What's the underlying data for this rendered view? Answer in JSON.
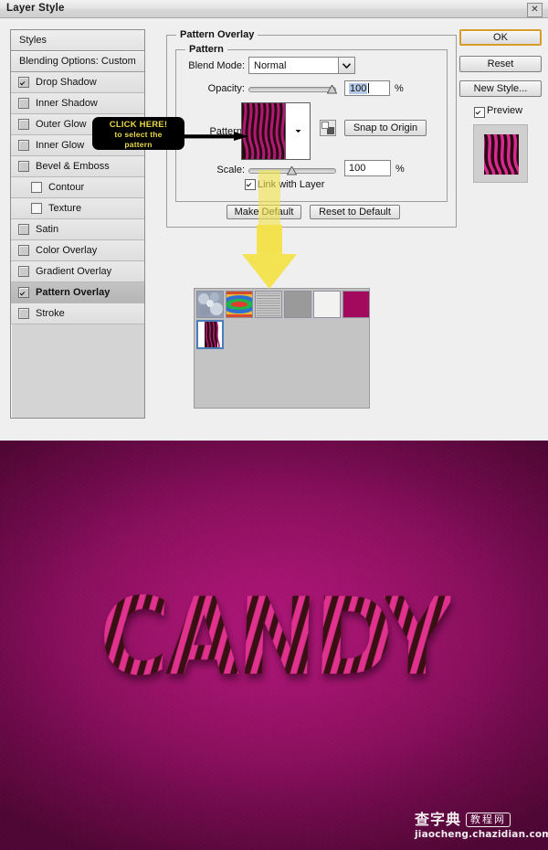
{
  "window": {
    "title": "Layer Style",
    "close_label": "✕"
  },
  "styles_panel": {
    "header": "Styles",
    "blending_options": "Blending Options: Custom",
    "effects": [
      {
        "label": "Drop Shadow",
        "checked": true,
        "indent": false,
        "selected": false
      },
      {
        "label": "Inner Shadow",
        "checked": false,
        "indent": false,
        "selected": false
      },
      {
        "label": "Outer Glow",
        "checked": false,
        "indent": false,
        "selected": false
      },
      {
        "label": "Inner Glow",
        "checked": false,
        "indent": false,
        "selected": false
      },
      {
        "label": "Bevel & Emboss",
        "checked": false,
        "indent": false,
        "selected": false
      },
      {
        "label": "Contour",
        "checked": false,
        "indent": true,
        "selected": false
      },
      {
        "label": "Texture",
        "checked": false,
        "indent": true,
        "selected": false
      },
      {
        "label": "Satin",
        "checked": false,
        "indent": false,
        "selected": false
      },
      {
        "label": "Color Overlay",
        "checked": false,
        "indent": false,
        "selected": false
      },
      {
        "label": "Gradient Overlay",
        "checked": false,
        "indent": false,
        "selected": false
      },
      {
        "label": "Pattern Overlay",
        "checked": true,
        "indent": false,
        "selected": true
      },
      {
        "label": "Stroke",
        "checked": false,
        "indent": false,
        "selected": false
      }
    ]
  },
  "pattern_overlay": {
    "section_title": "Pattern Overlay",
    "group_title": "Pattern",
    "blend_mode_label": "Blend Mode:",
    "blend_mode_value": "Normal",
    "opacity_label": "Opacity:",
    "opacity_value": "100",
    "opacity_unit": "%",
    "pattern_label": "Pattern:",
    "snap_to_origin": "Snap to Origin",
    "scale_label": "Scale:",
    "scale_value": "100",
    "scale_unit": "%",
    "link_with_layer_label": "Link with Layer",
    "link_with_layer_checked": true,
    "make_default": "Make Default",
    "reset_to_default": "Reset to Default"
  },
  "buttons": {
    "ok": "OK",
    "reset": "Reset",
    "new_style": "New Style...",
    "preview_label": "Preview",
    "preview_checked": true
  },
  "pattern_picker": {
    "row1": [
      {
        "name": "bubbles-pattern"
      },
      {
        "name": "rainbow-gradient-pattern"
      },
      {
        "name": "lined-paper-pattern"
      },
      {
        "name": "gray-fill-pattern"
      },
      {
        "name": "white-paper-pattern"
      },
      {
        "name": "magenta-fill-pattern"
      }
    ],
    "selected": {
      "name": "candy-stripe-pattern"
    }
  },
  "callout": {
    "line1": "CLICK HERE!",
    "line2": "to select the",
    "line3": "pattern"
  },
  "artwork": {
    "text": "CANDY",
    "background_color": "#a0136d",
    "stripe_light": "#e0318f",
    "stripe_dark": "#3a0f14"
  },
  "watermark": {
    "brand_cn": "查字典",
    "brand_box": "教程网",
    "url": "jiaocheng.chazidian.com"
  }
}
